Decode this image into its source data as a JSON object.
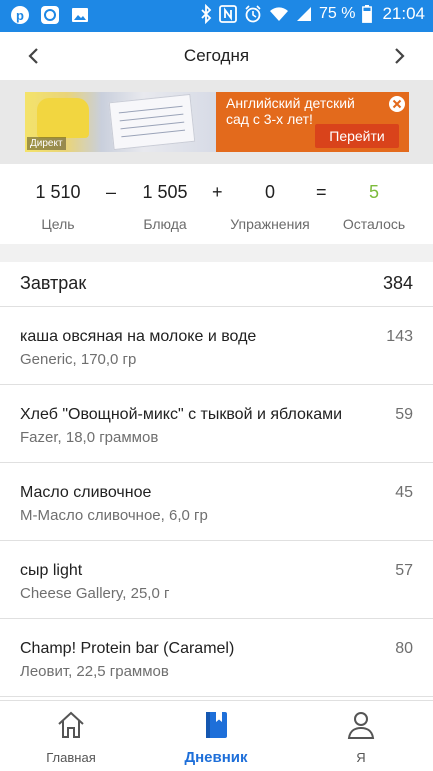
{
  "status_bar": {
    "battery_percent": "75 %",
    "time": "21:04",
    "icons_left": [
      "pinterest-icon",
      "mfp-app-icon",
      "image-icon"
    ],
    "icons_right": [
      "bluetooth-icon",
      "nfc-icon",
      "alarm-icon",
      "wifi-icon",
      "signal-icon",
      "battery-icon"
    ]
  },
  "header": {
    "title": "Сегодня"
  },
  "ad": {
    "label": "Директ",
    "text": "Английский детский сад с 3-х лет!",
    "button": "Перейти"
  },
  "summary": {
    "goal": "1 510",
    "goal_label": "Цель",
    "minus": "–",
    "food": "1 505",
    "food_label": "Блюда",
    "plus": "+",
    "exercise": "0",
    "exercise_label": "Упражнения",
    "equals": "=",
    "remaining": "5",
    "remaining_label": "Осталось"
  },
  "meal": {
    "title": "Завтрак",
    "total": "384",
    "items": [
      {
        "name": "каша овсяная на молоке и воде",
        "sub": "Generic, 170,0 гр",
        "cal": "143"
      },
      {
        "name": "Хлеб \"Овощной-микс\" с тыквой и яблоками",
        "sub": "Fazer, 18,0 граммов",
        "cal": "59"
      },
      {
        "name": "Масло сливочное",
        "sub": "М-Масло сливочное, 6,0 гр",
        "cal": "45"
      },
      {
        "name": "сыр light",
        "sub": "Cheese Gallery, 25,0 г",
        "cal": "57"
      },
      {
        "name": "Champ! Protein bar (Caramel)",
        "sub": "Леовит, 22,5 граммов",
        "cal": "80"
      }
    ]
  },
  "nav": {
    "home": "Главная",
    "diary": "Дневник",
    "me": "Я"
  },
  "colors": {
    "status_bar": "#1e88e5",
    "accent": "#1e6fd9",
    "remaining_green": "#7cbb3b",
    "ad_orange": "#e36a1c"
  }
}
